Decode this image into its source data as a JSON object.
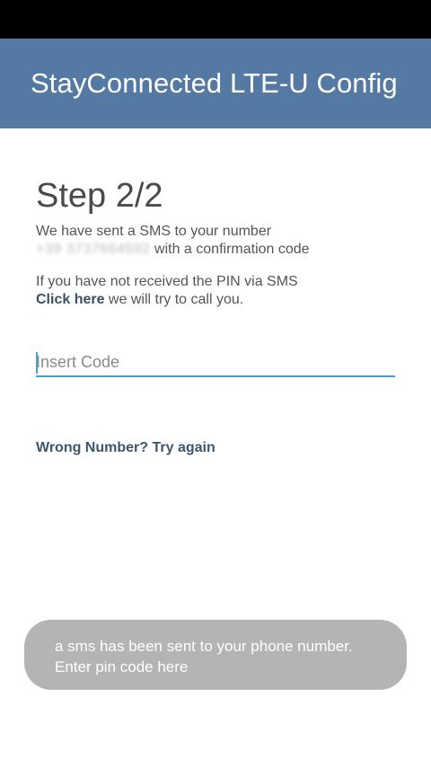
{
  "app": {
    "title": "StayConnected LTE-U Config"
  },
  "step": {
    "title": "Step 2/2",
    "sms_line1": "We have sent a SMS to your number",
    "phone_number_redacted": "+39 3737664592",
    "sms_line2_suffix": " with a confirmation code",
    "pin_line1": "If you have not received the PIN via SMS",
    "click_here_label": "Click here",
    "pin_line2_suffix": " we will try to call you."
  },
  "code_input": {
    "placeholder": "Insert Code",
    "value": ""
  },
  "wrong_number_label": "Wrong Number? Try again",
  "toast": {
    "line1": "a sms has been sent to your phone number.",
    "line2": "Enter pin code here"
  },
  "colors": {
    "app_bar": "#5479a3",
    "accent": "#4d9fcb",
    "toast_bg": "#b4b4b4"
  }
}
